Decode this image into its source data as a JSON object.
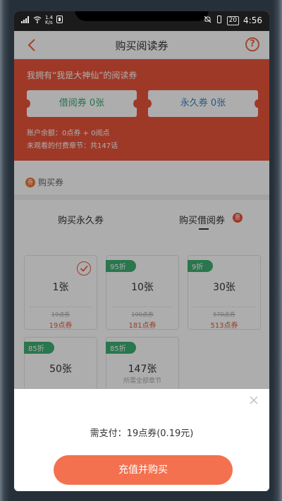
{
  "status_bar": {
    "network_speed_value": "1.4",
    "network_speed_unit": "K/s",
    "battery": "20",
    "time": "4:56"
  },
  "nav": {
    "title": "购买阅读券"
  },
  "banner": {
    "owner_line": "我拥有“我是大神仙”的阅读券",
    "borrow_voucher": "借阅券 0张",
    "permanent_voucher": "永久券 0张",
    "account_balance": "账户余额：0点券 + 0阅点",
    "unread_chapters": "未观看的付费章节：共147话"
  },
  "section": {
    "title": "购买券",
    "icon_text": "券"
  },
  "tabs": {
    "permanent": "购买永久券",
    "borrow": "购买借阅券",
    "badge": "惠"
  },
  "cards": [
    {
      "count": "1张",
      "old_price": "19点券",
      "price": "19点券",
      "selected": true
    },
    {
      "discount": "95折",
      "count": "10张",
      "old_price": "190点券",
      "price": "181点券"
    },
    {
      "discount": "9折",
      "count": "30张",
      "old_price": "570点券",
      "price": "513点券"
    },
    {
      "discount": "85折",
      "count": "50张"
    },
    {
      "discount": "85折",
      "count": "147张",
      "sub": "所需全部章节"
    }
  ],
  "sheet": {
    "pay_text": "需支付：19点券(0.19元)",
    "button": "充值并购买"
  },
  "colors": {
    "accent": "#e9543a",
    "button": "#f4714f",
    "discount_tag": "#3fae72"
  }
}
